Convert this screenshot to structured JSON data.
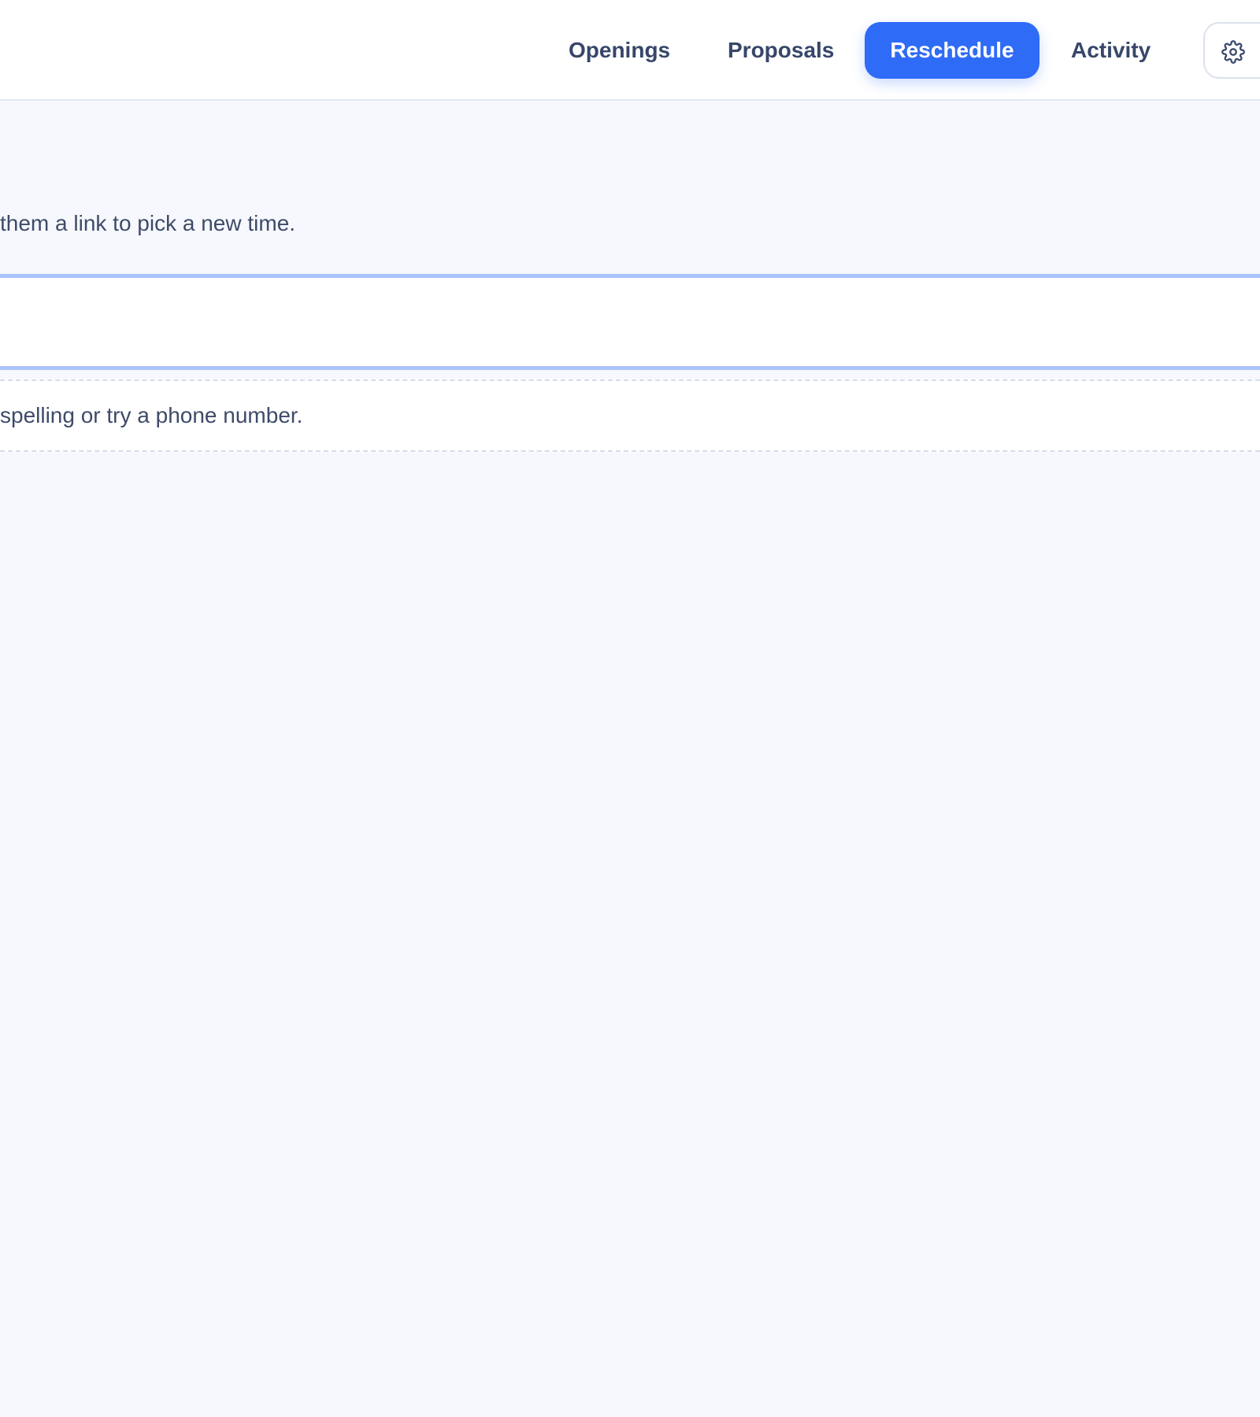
{
  "nav": {
    "tabs": [
      {
        "label": "Openings",
        "active": false
      },
      {
        "label": "Proposals",
        "active": false
      },
      {
        "label": "Reschedule",
        "active": true
      },
      {
        "label": "Activity",
        "active": false
      }
    ],
    "settings_icon": "gear-icon"
  },
  "reschedule": {
    "intro": "them a link to pick a new time.",
    "search_value": "",
    "no_results_hint": "spelling or try a phone number."
  },
  "colors": {
    "accent": "#2e6bf6",
    "background": "#f6f8fd",
    "text": "#37466a",
    "focus_border": "#a9c3fb"
  }
}
